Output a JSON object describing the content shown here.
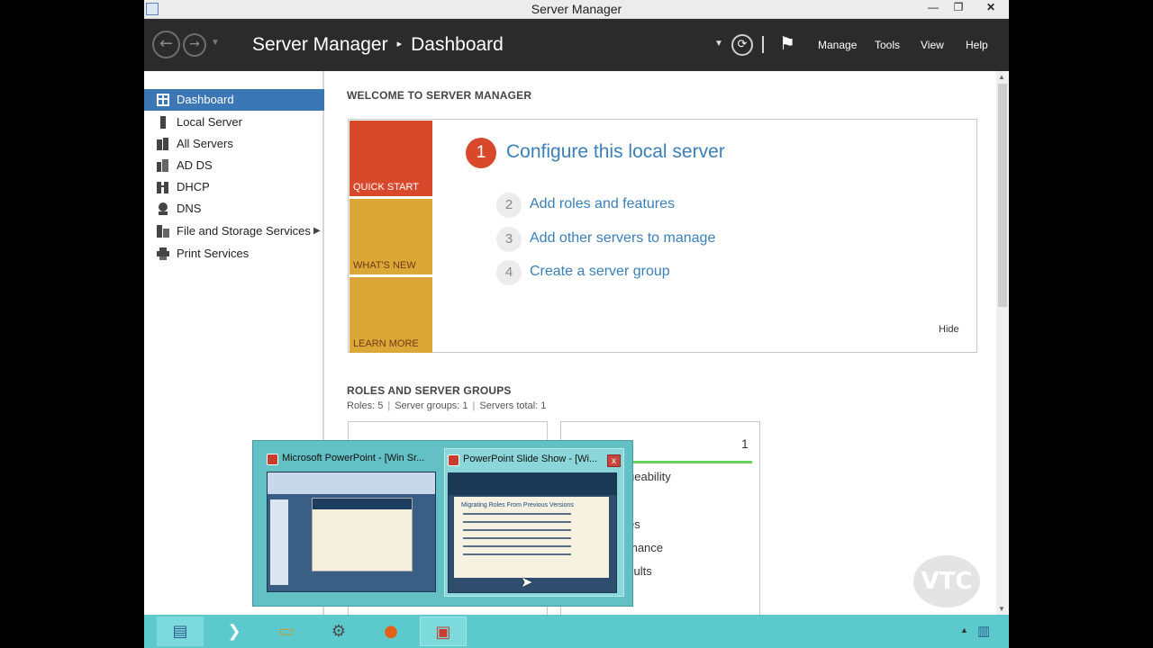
{
  "window": {
    "title": "Server Manager",
    "controls": {
      "minimize": "—",
      "maximize": "❐",
      "close": "✕"
    }
  },
  "header": {
    "breadcrumb_root": "Server Manager",
    "breadcrumb_sep": "▸",
    "breadcrumb_page": "Dashboard",
    "menus": [
      "Manage",
      "Tools",
      "View",
      "Help"
    ]
  },
  "sidebar": {
    "items": [
      {
        "label": "Dashboard",
        "icon": "dashboard-icon",
        "active": true
      },
      {
        "label": "Local Server",
        "icon": "server-icon"
      },
      {
        "label": "All Servers",
        "icon": "servers-icon"
      },
      {
        "label": "AD DS",
        "icon": "ad-ds-icon"
      },
      {
        "label": "DHCP",
        "icon": "dhcp-icon"
      },
      {
        "label": "DNS",
        "icon": "dns-icon"
      },
      {
        "label": "File and Storage Services",
        "icon": "storage-icon",
        "expandable": true
      },
      {
        "label": "Print Services",
        "icon": "printer-icon"
      }
    ]
  },
  "welcome": {
    "title": "WELCOME TO SERVER MANAGER",
    "tiles": [
      "QUICK START",
      "WHAT'S NEW",
      "LEARN MORE"
    ],
    "step1": {
      "num": "1",
      "label": "Configure this local server"
    },
    "steps": [
      {
        "num": "2",
        "label": "Add roles and features"
      },
      {
        "num": "3",
        "label": "Add other servers to manage"
      },
      {
        "num": "4",
        "label": "Create a server group"
      }
    ],
    "hide": "Hide"
  },
  "roles": {
    "title": "ROLES AND SERVER GROUPS",
    "roles": "Roles: 5",
    "groups": "Server groups: 1",
    "total": "Servers total: 1",
    "card2": {
      "count": "1",
      "lines": [
        "geability",
        "es",
        "mance",
        "sults"
      ]
    },
    "colors": {
      "ok_bar": "#66d35c"
    }
  },
  "thumbnails": [
    {
      "title": "Microsoft PowerPoint - [Win Sr..."
    },
    {
      "title": "PowerPoint Slide Show - [Wi...",
      "close": "x",
      "slide_title": "Migrating Roles From Previous Versions"
    }
  ],
  "taskbar": {
    "apps": [
      "server-manager-icon",
      "powershell-icon",
      "file-explorer-icon",
      "admin-tools-icon",
      "firefox-icon",
      "powerpoint-icon"
    ],
    "tray_arrow": "▲"
  },
  "watermark": "VTC",
  "theme": {
    "accent": "#3b77b5",
    "quick_start": "#d8482a",
    "tile_gold": "#dba838",
    "header_bg": "#2b2b2b",
    "taskbar": "#5ccacd"
  }
}
